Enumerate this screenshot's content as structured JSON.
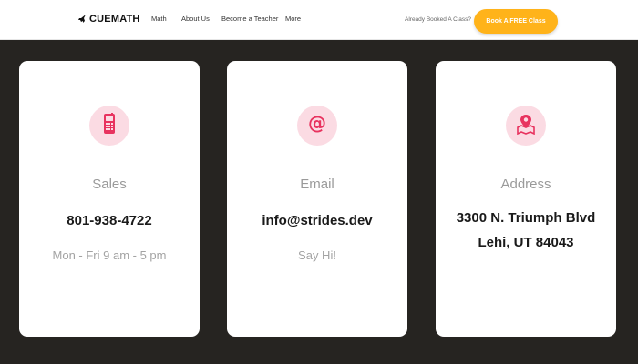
{
  "nav": {
    "logo_text": "CUEMATH",
    "links": [
      "Math",
      "About Us",
      "Become a Teacher",
      "More"
    ],
    "booked_text": "Already Booked A Class?",
    "cta_label": "Book A FREE Class",
    "cta_color": "#ffb31a"
  },
  "cards": [
    {
      "icon": "phone-icon",
      "label": "Sales",
      "value": "801-938-4722",
      "sub": "Mon - Fri 9 am - 5 pm"
    },
    {
      "icon": "at-sign-icon",
      "label": "Email",
      "value": "info@strides.dev",
      "sub": "Say Hi!"
    },
    {
      "icon": "map-pin-icon",
      "label": "Address",
      "value_lines": [
        "3300 N. Triumph Blvd",
        "Lehi, UT 84043"
      ]
    }
  ],
  "colors": {
    "background": "#262421",
    "icon_bg": "#fbdbe3",
    "accent_pink": "#e8335f"
  }
}
